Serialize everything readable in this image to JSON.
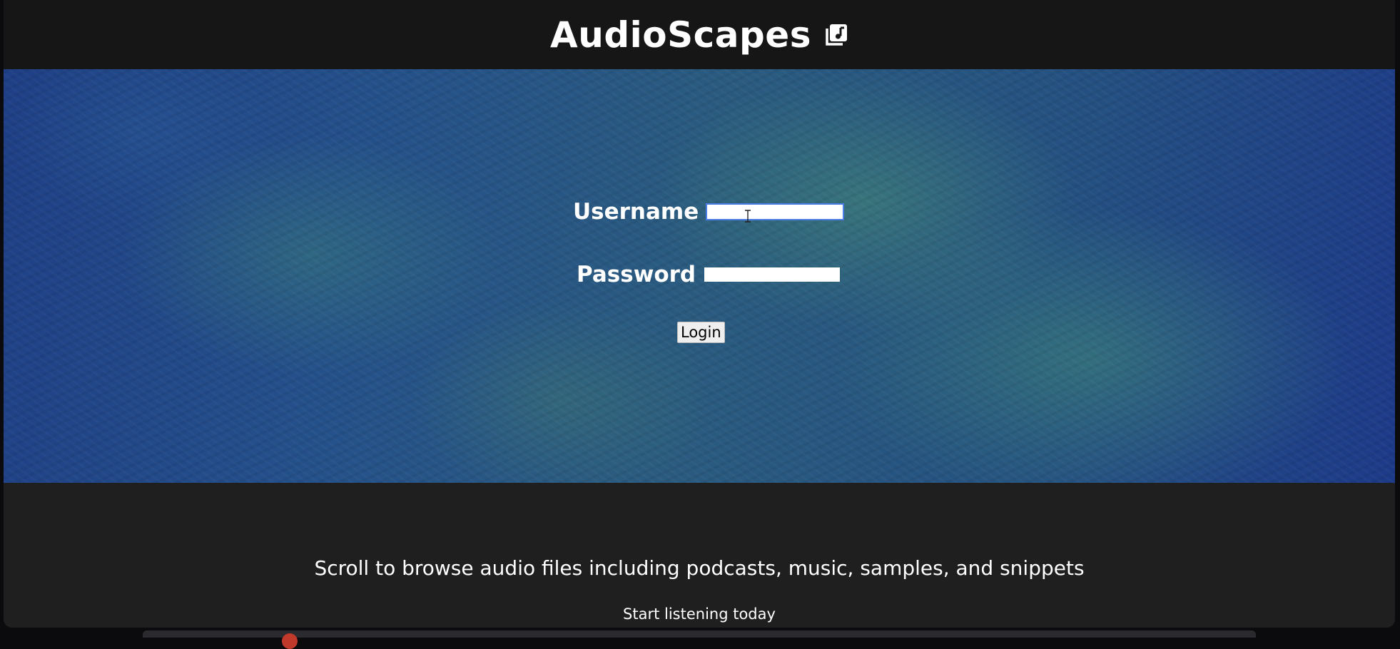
{
  "header": {
    "title": "AudioScapes",
    "icon": "music-note-square-icon"
  },
  "login": {
    "username_label": "Username",
    "username_value": "",
    "password_label": "Password",
    "password_value": "",
    "submit_label": "Login"
  },
  "footer": {
    "tagline": "Scroll to browse audio files including podcasts, music, samples, and snippets",
    "subtext": "Start listening today"
  },
  "colors": {
    "header_bg": "#161616",
    "footer_bg": "#1f1f1f",
    "hero_accent": "#2a5b7f",
    "focus_ring": "#4b7be5"
  }
}
